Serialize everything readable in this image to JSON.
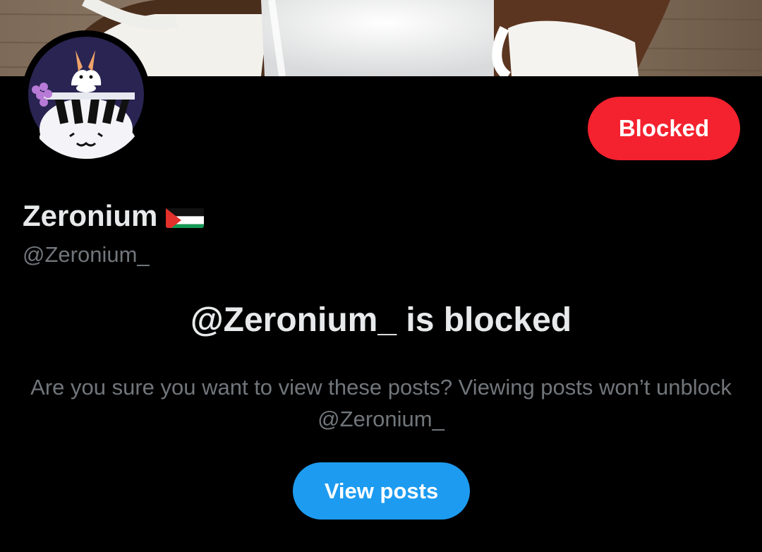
{
  "profile": {
    "display_name": "Zeronium",
    "name_emoji": "palestine-flag-icon",
    "handle": "@Zeronium_"
  },
  "header": {
    "banner_image": "coconut-milk-banner",
    "avatar_image": "anime-avatar"
  },
  "actions": {
    "blocked_label": "Blocked"
  },
  "block_notice": {
    "title": "@Zeronium_ is blocked",
    "description": "Are you sure you want to view these posts? Viewing posts won’t unblock @Zeronium_",
    "view_posts_label": "View posts"
  },
  "colors": {
    "background": "#000000",
    "blocked_button": "#f4212e",
    "primary_button": "#1d9bf0",
    "text_primary": "#e7e9ea",
    "text_secondary": "#71767b"
  }
}
